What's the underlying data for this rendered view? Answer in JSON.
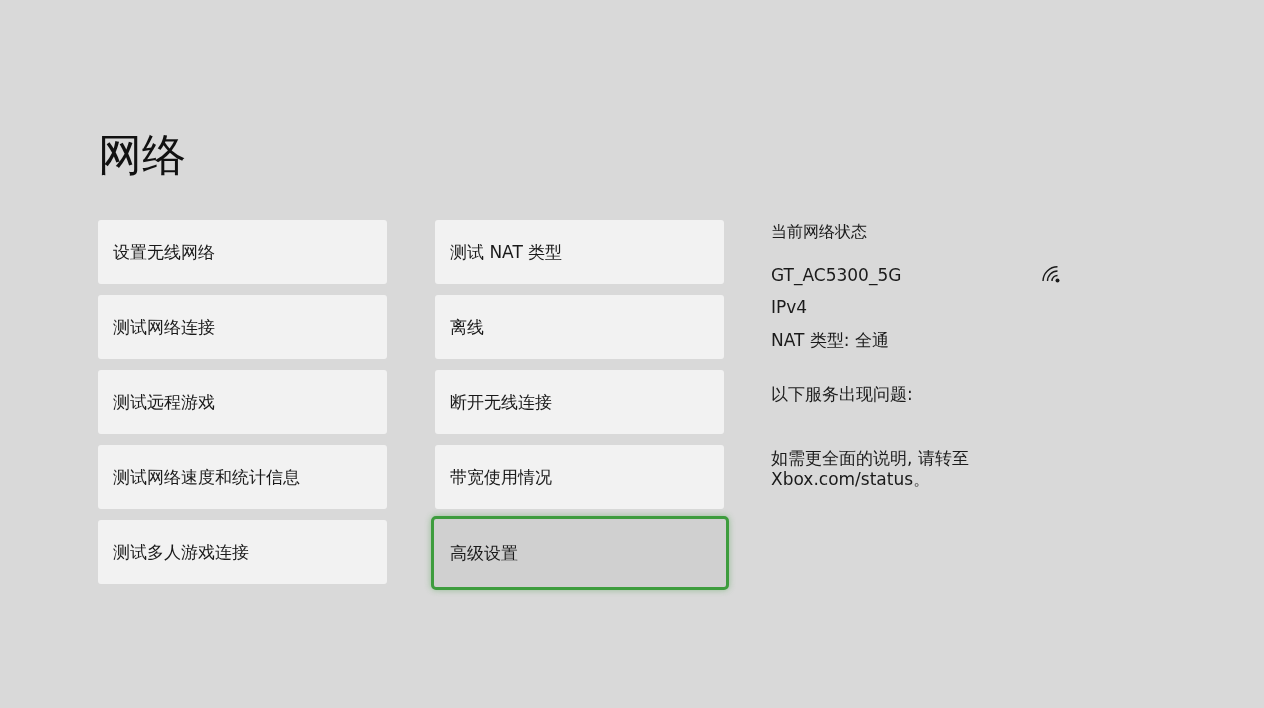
{
  "page": {
    "title": "网络"
  },
  "menu_columns": [
    {
      "items": [
        {
          "label": "设置无线网络",
          "selected": false
        },
        {
          "label": "测试网络连接",
          "selected": false
        },
        {
          "label": "测试远程游戏",
          "selected": false
        },
        {
          "label": "测试网络速度和统计信息",
          "selected": false
        },
        {
          "label": "测试多人游戏连接",
          "selected": false
        }
      ]
    },
    {
      "items": [
        {
          "label": "测试 NAT 类型",
          "selected": false
        },
        {
          "label": "离线",
          "selected": false
        },
        {
          "label": "断开无线连接",
          "selected": false
        },
        {
          "label": "带宽使用情况",
          "selected": false
        },
        {
          "label": "高级设置",
          "selected": true
        }
      ]
    }
  ],
  "status": {
    "heading": "当前网络状态",
    "network_name": "GT_AC5300_5G",
    "protocol": "IPv4",
    "nat_type": "NAT 类型: 全通",
    "services_heading": "以下服务出现问题:",
    "more_info": "如需更全面的说明, 请转至 Xbox.com/status。"
  }
}
